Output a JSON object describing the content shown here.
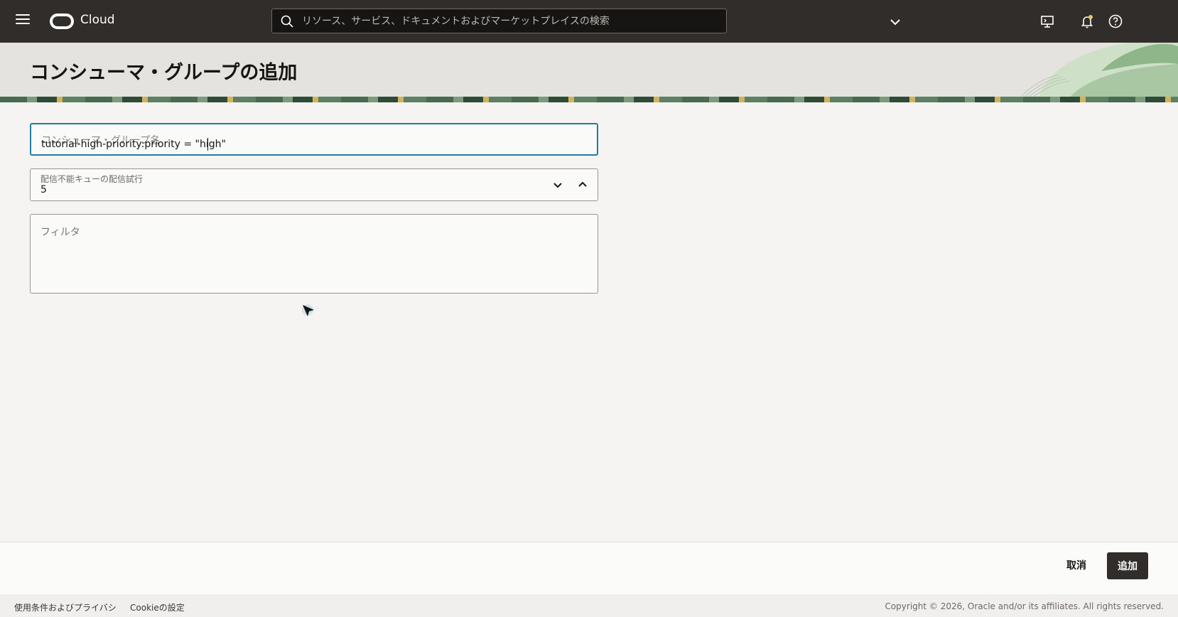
{
  "header": {
    "logo_text": "Cloud",
    "search_placeholder": "リソース、サービス、ドキュメントおよびマーケットプレイスの検索"
  },
  "page": {
    "title": "コンシューマ・グループの追加"
  },
  "form": {
    "group_name": {
      "label": "コンシューマ・グループ名",
      "value": "tutorial-high-priority:priority = \"high\""
    },
    "dlq_attempts": {
      "label": "配信不能キューの配信試行",
      "value": "5"
    },
    "filter": {
      "label": "フィルタ"
    }
  },
  "actions": {
    "cancel_label": "取消",
    "add_label": "追加"
  },
  "legal": {
    "terms_label": "使用条件およびプライバシ",
    "cookie_label": "Cookieの設定",
    "copyright": "Copyright © 2026, Oracle and/or its affiliates. All rights reserved."
  },
  "colors": {
    "header_bg": "#312d2a",
    "focus_border": "#227e9e",
    "primary_button": "#312d2a"
  }
}
